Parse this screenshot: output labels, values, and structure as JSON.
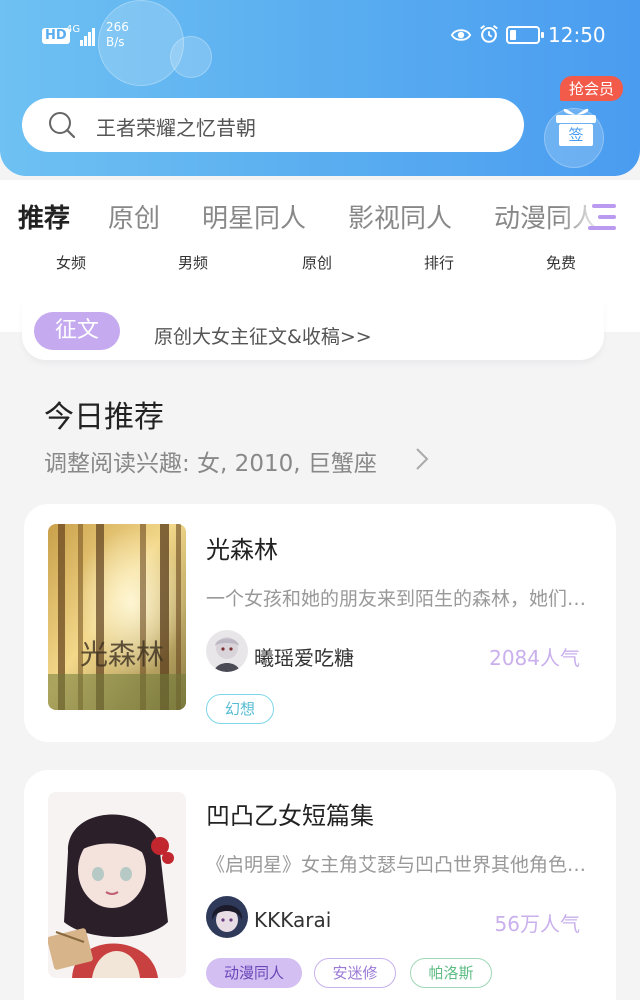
{
  "status_bar": {
    "hd_label": "HD",
    "network_label": "4G",
    "speed_value": "266",
    "speed_unit": "B/s",
    "time": "12:50"
  },
  "search": {
    "query": "王者荣耀之忆昔朝"
  },
  "vip": {
    "badge_label": "抢会员",
    "sign_label": "签"
  },
  "tabs": [
    {
      "label": "推荐"
    },
    {
      "label": "原创"
    },
    {
      "label": "明星同人"
    },
    {
      "label": "影视同人"
    },
    {
      "label": "动漫同人"
    }
  ],
  "subtabs": [
    {
      "label": "女频"
    },
    {
      "label": "男频"
    },
    {
      "label": "原创"
    },
    {
      "label": "排行"
    },
    {
      "label": "免费"
    }
  ],
  "notice": {
    "tag": "征文",
    "text": "原创大女主征文&收稿>>"
  },
  "recommend": {
    "title": "今日推荐",
    "subtitle": "调整阅读兴趣: 女, 2010, 巨蟹座"
  },
  "books": [
    {
      "title": "光森林",
      "cover_text": "光森林",
      "description": "一个女孩和她的朋友来到陌生的森林，她们……",
      "author": "曦瑶爱吃糖",
      "popularity": "2084人气",
      "tags": [
        "幻想"
      ]
    },
    {
      "title": "凹凸乙女短篇集",
      "description": "《启明星》女主角艾瑟与凹凸世界其他角色……",
      "author": "KKKarai",
      "popularity": "56万人气",
      "tags": [
        "动漫同人",
        "安迷修",
        "帕洛斯"
      ]
    }
  ],
  "colors": {
    "header_gradient_start": "#6ec1f2",
    "header_gradient_end": "#4a9cf0",
    "accent_purple": "#a889e6",
    "vip_red": "#f25a4a"
  }
}
